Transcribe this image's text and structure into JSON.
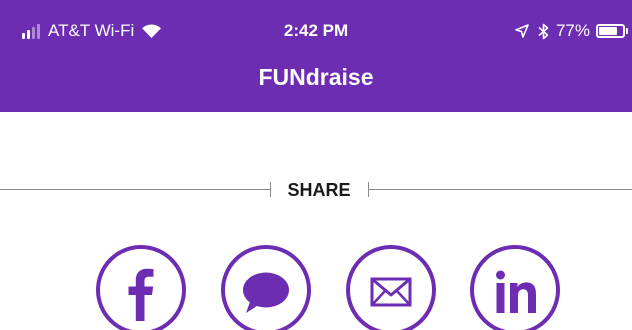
{
  "status_bar": {
    "carrier": "AT&T Wi-Fi",
    "time": "2:42 PM",
    "battery_percent_text": "77%",
    "battery_level": 0.77,
    "signal_bars": 4,
    "signal_bars_active": 2,
    "icons": [
      "signal-icon",
      "wifi-icon",
      "location-icon",
      "bluetooth-icon",
      "battery-icon"
    ]
  },
  "nav": {
    "title": "FUNdraise"
  },
  "share": {
    "label": "SHARE",
    "buttons": [
      {
        "name": "facebook",
        "icon": "facebook-icon"
      },
      {
        "name": "messages",
        "icon": "message-bubble-icon"
      },
      {
        "name": "email",
        "icon": "envelope-icon"
      },
      {
        "name": "linkedin",
        "icon": "linkedin-icon"
      }
    ]
  },
  "colors": {
    "brand_purple": "#6d2db3",
    "background": "#ffffff",
    "text_dark": "#1a1a1a",
    "rule_gray": "#8a8a8a"
  }
}
